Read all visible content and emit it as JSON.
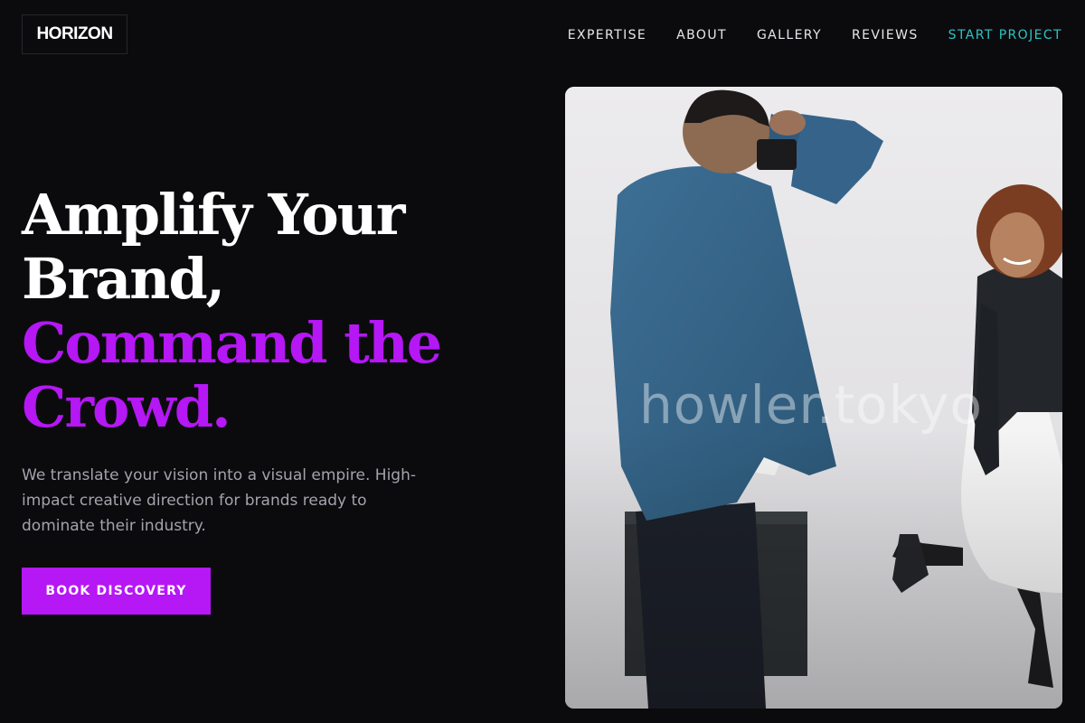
{
  "header": {
    "logo": "HORIZON",
    "nav": [
      {
        "label": "EXPERTISE"
      },
      {
        "label": "ABOUT"
      },
      {
        "label": "GALLERY"
      },
      {
        "label": "REVIEWS"
      },
      {
        "label": "START PROJECT",
        "accent": true
      }
    ]
  },
  "hero": {
    "headline": {
      "line1": "Amplify Your",
      "line2": "Brand,",
      "line3": "Command the",
      "line4": "Crowd."
    },
    "subtext": "We translate your vision into a visual empire. High-impact creative direction for brands ready to dominate their industry.",
    "cta_label": "BOOK DISCOVERY",
    "image": {
      "description": "photographer shooting model in studio",
      "watermark": "howler.tokyo"
    }
  },
  "colors": {
    "background": "#0b0b0d",
    "accent_purple": "#b517f5",
    "accent_teal": "#2ec4c4",
    "text_muted": "#a3a3ad"
  }
}
